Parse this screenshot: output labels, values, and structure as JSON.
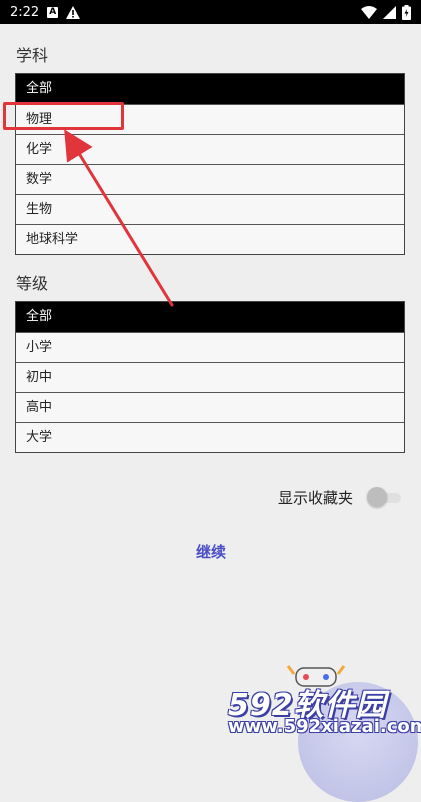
{
  "status_bar": {
    "time": "2:22",
    "a_badge": "A"
  },
  "subject": {
    "label": "学科",
    "items": [
      "全部",
      "物理",
      "化学",
      "数学",
      "生物",
      "地球科学"
    ],
    "selected_index": 0
  },
  "level": {
    "label": "等级",
    "items": [
      "全部",
      "小学",
      "初中",
      "高中",
      "大学"
    ],
    "selected_index": 0
  },
  "favorites_toggle": {
    "label": "显示收藏夹",
    "on": false
  },
  "continue_label": "继续",
  "watermark": {
    "brand": "592软件园",
    "url": "www.592xiazai.com"
  },
  "colors": {
    "highlight": "#e0353b",
    "accent": "#4a4fc8",
    "selected_row": "#000000"
  }
}
